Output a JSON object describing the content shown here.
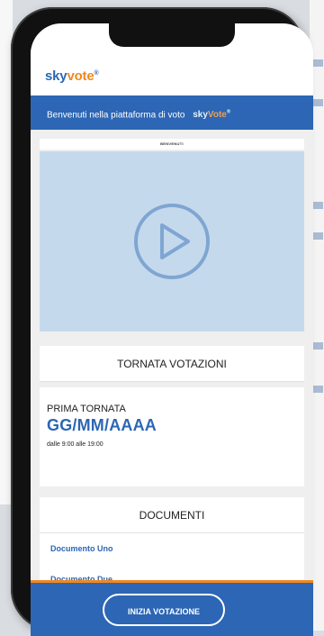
{
  "brand": {
    "logo_sky": "sky",
    "logo_vote": "vote",
    "logo_reg": "®"
  },
  "welcome": {
    "text": "Benvenuti nella piattaforma di voto",
    "logo_sky": "sky",
    "logo_vote": "Vote",
    "logo_reg": "®"
  },
  "video": {
    "caption": "BENVENUTI"
  },
  "turn_section": {
    "heading": "TORNATA VOTAZIONI",
    "label": "PRIMA TORNATA",
    "date": "GG/MM/AAAA",
    "time": "dalle 9:00 alle 19:00"
  },
  "documents": {
    "heading": "DOCUMENTI",
    "items": [
      "Documento Uno",
      "Documento Due"
    ]
  },
  "footer": {
    "button_label": "INIZIA VOTAZIONE"
  },
  "colors": {
    "brand_blue": "#2c66b4",
    "accent_orange": "#f0881e",
    "video_bg": "#c5d9ec"
  }
}
